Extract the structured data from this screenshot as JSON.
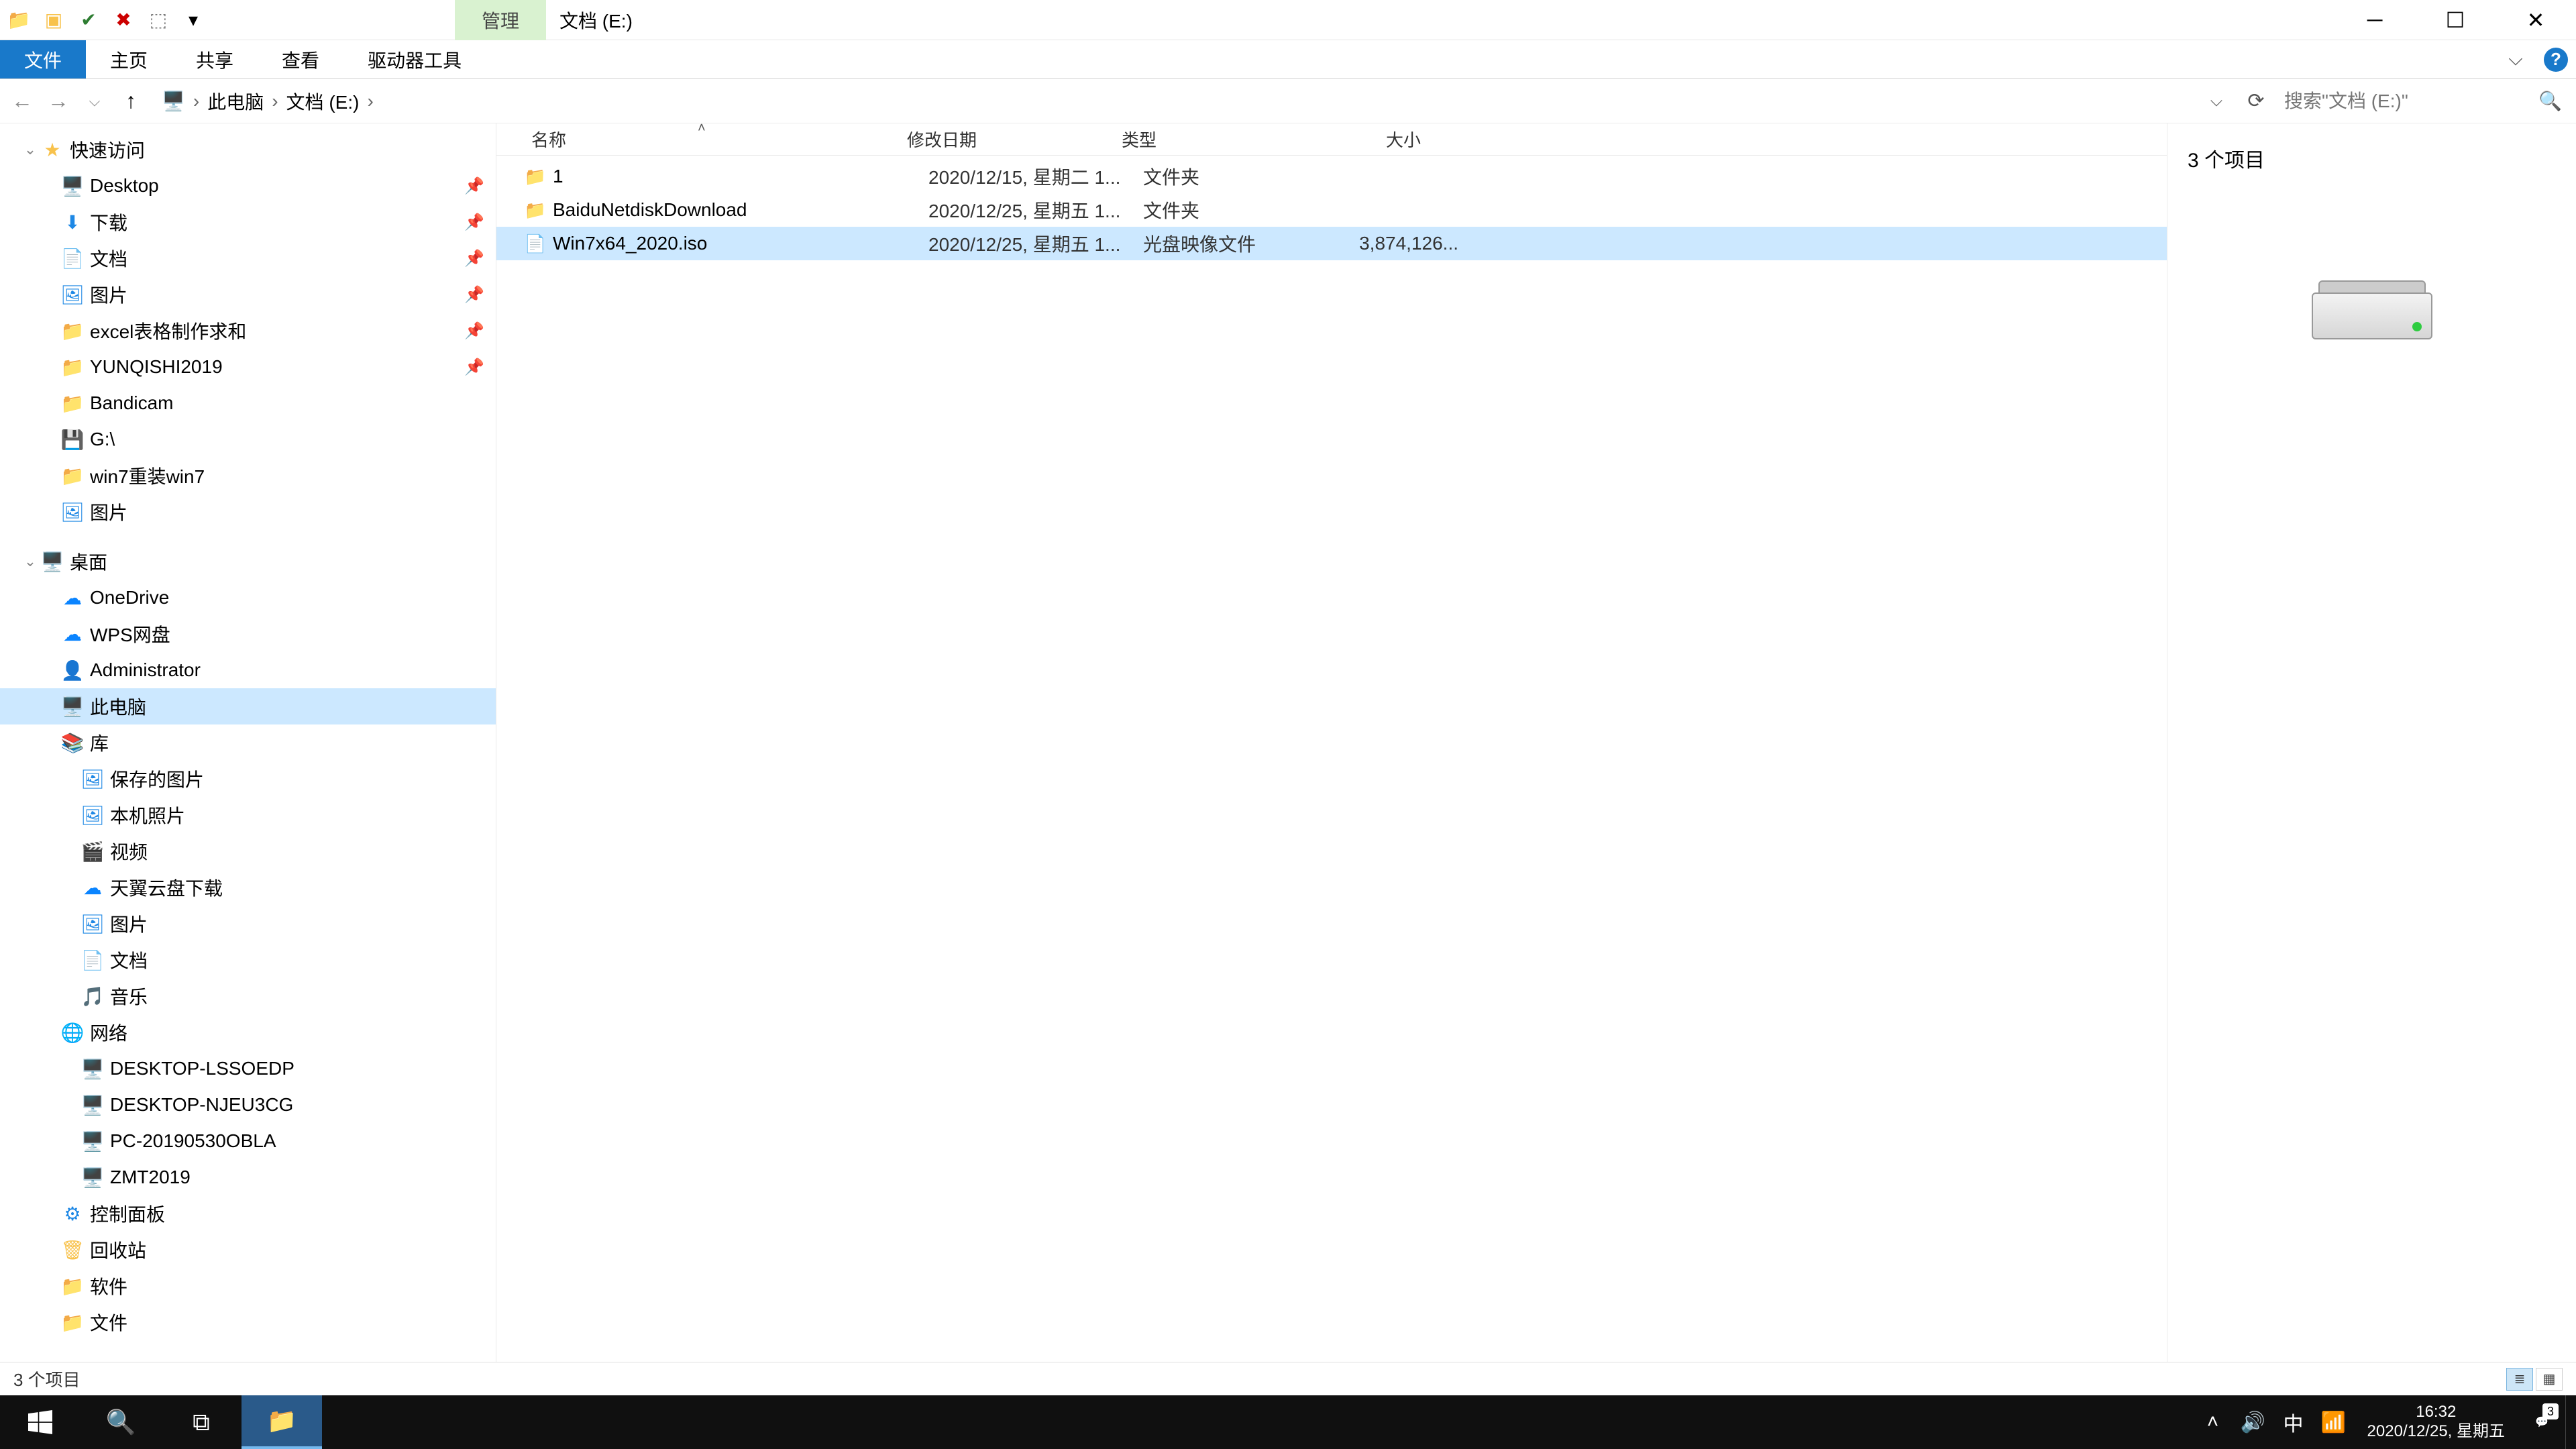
{
  "titlebar": {
    "context_tab": "管理",
    "window_title": "文档 (E:)",
    "qat": {
      "dropdown": "▾"
    }
  },
  "ribbon": {
    "file": "文件",
    "home": "主页",
    "share": "共享",
    "view": "查看",
    "drive_tools": "驱动器工具"
  },
  "address": {
    "seg1": "此电脑",
    "seg2": "文档 (E:)",
    "search_placeholder": "搜索\"文档 (E:)\""
  },
  "tree": {
    "quick_access": "快速访问",
    "qa_items": [
      {
        "icon": "🖥️",
        "label": "Desktop",
        "pin": true,
        "cls": "fc-desktop"
      },
      {
        "icon": "⬇",
        "label": "下载",
        "pin": true,
        "cls": "fc-blue"
      },
      {
        "icon": "📄",
        "label": "文档",
        "pin": true,
        "cls": "fc-folder"
      },
      {
        "icon": "🖼",
        "label": "图片",
        "pin": true,
        "cls": "fc-blue"
      },
      {
        "icon": "📁",
        "label": "excel表格制作求和",
        "pin": true,
        "cls": "fc-folder"
      },
      {
        "icon": "📁",
        "label": "YUNQISHI2019",
        "pin": true,
        "cls": "fc-folder"
      },
      {
        "icon": "📁",
        "label": "Bandicam",
        "pin": false,
        "cls": "fc-folder"
      },
      {
        "icon": "💾",
        "label": "G:\\",
        "pin": false,
        "cls": "fc-drive"
      },
      {
        "icon": "📁",
        "label": "win7重装win7",
        "pin": false,
        "cls": "fc-folder"
      },
      {
        "icon": "🖼",
        "label": "图片",
        "pin": false,
        "cls": "fc-blue"
      }
    ],
    "desktop": "桌面",
    "desktop_items": [
      {
        "icon": "☁",
        "label": "OneDrive",
        "cls": "fc-cloud"
      },
      {
        "icon": "☁",
        "label": "WPS网盘",
        "cls": "fc-cloud"
      },
      {
        "icon": "👤",
        "label": "Administrator",
        "cls": "fc-folder"
      },
      {
        "icon": "🖥️",
        "label": "此电脑",
        "cls": "fc-desktop",
        "sel": true
      },
      {
        "icon": "📚",
        "label": "库",
        "cls": "fc-folder"
      },
      {
        "icon": "🖼",
        "label": "保存的图片",
        "cls": "fc-blue",
        "indent": 1
      },
      {
        "icon": "🖼",
        "label": "本机照片",
        "cls": "fc-blue",
        "indent": 1
      },
      {
        "icon": "🎬",
        "label": "视频",
        "cls": "fc-folder",
        "indent": 1
      },
      {
        "icon": "☁",
        "label": "天翼云盘下载",
        "cls": "fc-cloud",
        "indent": 1
      },
      {
        "icon": "🖼",
        "label": "图片",
        "cls": "fc-blue",
        "indent": 1
      },
      {
        "icon": "📄",
        "label": "文档",
        "cls": "fc-folder",
        "indent": 1
      },
      {
        "icon": "🎵",
        "label": "音乐",
        "cls": "fc-folder",
        "indent": 1
      },
      {
        "icon": "🌐",
        "label": "网络",
        "cls": "fc-net"
      },
      {
        "icon": "🖥️",
        "label": "DESKTOP-LSSOEDP",
        "cls": "fc-desktop",
        "indent": 1
      },
      {
        "icon": "🖥️",
        "label": "DESKTOP-NJEU3CG",
        "cls": "fc-desktop",
        "indent": 1
      },
      {
        "icon": "🖥️",
        "label": "PC-20190530OBLA",
        "cls": "fc-desktop",
        "indent": 1
      },
      {
        "icon": "🖥️",
        "label": "ZMT2019",
        "cls": "fc-desktop",
        "indent": 1
      },
      {
        "icon": "⚙",
        "label": "控制面板",
        "cls": "fc-blue"
      },
      {
        "icon": "🗑",
        "label": "回收站",
        "cls": "fc-folder"
      },
      {
        "icon": "📁",
        "label": "软件",
        "cls": "fc-folder"
      },
      {
        "icon": "📁",
        "label": "文件",
        "cls": "fc-folder"
      }
    ]
  },
  "columns": {
    "name": "名称",
    "date": "修改日期",
    "type": "类型",
    "size": "大小"
  },
  "files": [
    {
      "icon": "📁",
      "name": "1",
      "date": "2020/12/15, 星期二 1...",
      "type": "文件夹",
      "size": "",
      "cls": "fc-folder"
    },
    {
      "icon": "📁",
      "name": "BaiduNetdiskDownload",
      "date": "2020/12/25, 星期五 1...",
      "type": "文件夹",
      "size": "",
      "cls": "fc-folder"
    },
    {
      "icon": "📄",
      "name": "Win7x64_2020.iso",
      "date": "2020/12/25, 星期五 1...",
      "type": "光盘映像文件",
      "size": "3,874,126...",
      "cls": "fc-file",
      "sel": true
    }
  ],
  "preview": {
    "count_label": "3 个项目"
  },
  "status": {
    "text": "3 个项目"
  },
  "taskbar": {
    "time": "16:32",
    "date": "2020/12/25, 星期五",
    "ime": "中",
    "notif_count": "3"
  }
}
